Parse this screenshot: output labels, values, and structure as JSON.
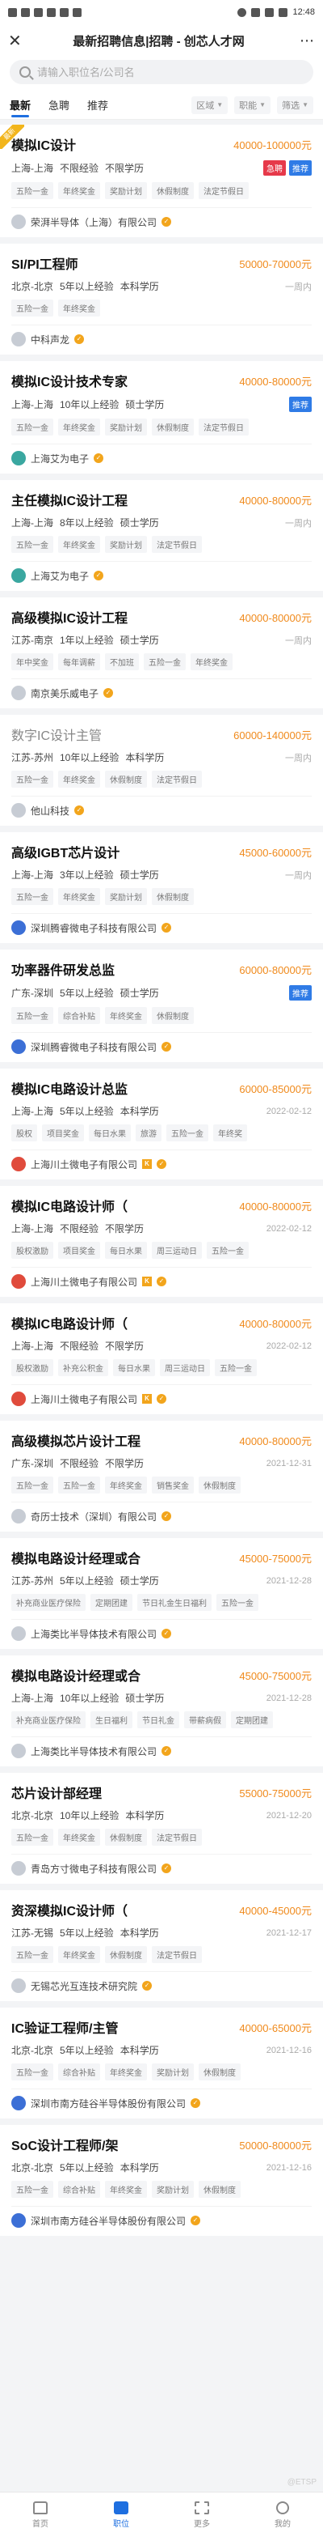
{
  "status_bar": {
    "left_icons": [
      "app-icon",
      "app-icon",
      "app-icon",
      "app-icon",
      "app-icon",
      "app-icon"
    ],
    "right": "12:48"
  },
  "header": {
    "title": "最新招聘信息|招聘 - 创芯人才网"
  },
  "search": {
    "placeholder": "请输入职位名/公司名"
  },
  "tabs": [
    {
      "label": "最新",
      "active": true
    },
    {
      "label": "急聘",
      "active": false
    },
    {
      "label": "推荐",
      "active": false
    }
  ],
  "filters": [
    {
      "label": "区域"
    },
    {
      "label": "职能"
    },
    {
      "label": "筛选"
    }
  ],
  "jobs": [
    {
      "title": "模拟IC设计",
      "salary": "40000-100000元",
      "reqs": [
        "上海-上海",
        "不限经验",
        "不限学历"
      ],
      "badges": [
        "急聘",
        "推荐"
      ],
      "tags": [
        "五险一金",
        "年终奖金",
        "奖励计划",
        "休假制度",
        "法定节假日"
      ],
      "company": "荣湃半导体（上海）有限公司",
      "ribbon": "最新"
    },
    {
      "title": "SI/PI工程师",
      "salary": "50000-70000元",
      "reqs": [
        "北京-北京",
        "5年以上经验",
        "本科学历"
      ],
      "date": "一周内",
      "tags": [
        "五险一金",
        "年终奖金"
      ],
      "company": "中科声龙"
    },
    {
      "title": "模拟IC设计技术专家",
      "salary": "40000-80000元",
      "reqs": [
        "上海-上海",
        "10年以上经验",
        "硕士学历"
      ],
      "badges": [
        "推荐"
      ],
      "tags": [
        "五险一金",
        "年终奖金",
        "奖励计划",
        "休假制度",
        "法定节假日"
      ],
      "company": "上海艾为电子"
    },
    {
      "title": "主任模拟IC设计工程",
      "salary": "40000-80000元",
      "reqs": [
        "上海-上海",
        "8年以上经验",
        "硕士学历"
      ],
      "date": "一周内",
      "tags": [
        "五险一金",
        "年终奖金",
        "奖励计划",
        "法定节假日"
      ],
      "company": "上海艾为电子"
    },
    {
      "title": "高级模拟IC设计工程",
      "salary": "40000-80000元",
      "reqs": [
        "江苏-南京",
        "1年以上经验",
        "硕士学历"
      ],
      "date": "一周内",
      "tags": [
        "年中奖金",
        "每年调薪",
        "不加班",
        "五险一金",
        "年终奖金"
      ],
      "company": "南京美乐威电子"
    },
    {
      "title": "数字IC设计主管",
      "salary": "60000-140000元",
      "reqs": [
        "江苏-苏州",
        "10年以上经验",
        "本科学历"
      ],
      "date": "一周内",
      "tags": [
        "五险一金",
        "年终奖金",
        "休假制度",
        "法定节假日"
      ],
      "company": "他山科技",
      "muted": true
    },
    {
      "title": "高级IGBT芯片设计",
      "salary": "45000-60000元",
      "reqs": [
        "上海-上海",
        "3年以上经验",
        "硕士学历"
      ],
      "date": "一周内",
      "tags": [
        "五险一金",
        "年终奖金",
        "奖励计划",
        "休假制度"
      ],
      "company": "深圳腾睿微电子科技有限公司"
    },
    {
      "title": "功率器件研发总监",
      "salary": "60000-80000元",
      "reqs": [
        "广东-深圳",
        "5年以上经验",
        "硕士学历"
      ],
      "badges": [
        "推荐"
      ],
      "tags": [
        "五险一金",
        "综合补贴",
        "年终奖金",
        "休假制度"
      ],
      "company": "深圳腾睿微电子科技有限公司"
    },
    {
      "title": "模拟IC电路设计总监",
      "salary": "60000-85000元",
      "reqs": [
        "上海-上海",
        "5年以上经验",
        "本科学历"
      ],
      "date": "2022-02-12",
      "tags": [
        "股权",
        "项目奖金",
        "每日水果",
        "旅游",
        "五险一金",
        "年终奖"
      ],
      "company": "上海川土微电子有限公司"
    },
    {
      "title": "模拟IC电路设计师（",
      "salary": "40000-80000元",
      "reqs": [
        "上海-上海",
        "不限经验",
        "不限学历"
      ],
      "date": "2022-02-12",
      "tags": [
        "股权激励",
        "项目奖金",
        "每日水果",
        "周三运动日",
        "五险一金"
      ],
      "company": "上海川土微电子有限公司"
    },
    {
      "title": "模拟IC电路设计师（",
      "salary": "40000-80000元",
      "reqs": [
        "上海-上海",
        "不限经验",
        "不限学历"
      ],
      "date": "2022-02-12",
      "tags": [
        "股权激励",
        "补充公积金",
        "每日水果",
        "周三运动日",
        "五险一金"
      ],
      "company": "上海川土微电子有限公司"
    },
    {
      "title": "高级模拟芯片设计工程",
      "salary": "40000-80000元",
      "reqs": [
        "广东-深圳",
        "不限经验",
        "不限学历"
      ],
      "date": "2021-12-31",
      "tags": [
        "五险一金",
        "五险一金",
        "年终奖金",
        "销售奖金",
        "休假制度"
      ],
      "company": "奇历士技术（深圳）有限公司"
    },
    {
      "title": "模拟电路设计经理或合",
      "salary": "45000-75000元",
      "reqs": [
        "江苏-苏州",
        "5年以上经验",
        "硕士学历"
      ],
      "date": "2021-12-28",
      "tags": [
        "补充商业医疗保险",
        "定期团建",
        "节日礼金生日福利",
        "五险一金"
      ],
      "company": "上海类比半导体技术有限公司"
    },
    {
      "title": "模拟电路设计经理或合",
      "salary": "45000-75000元",
      "reqs": [
        "上海-上海",
        "10年以上经验",
        "硕士学历"
      ],
      "date": "2021-12-28",
      "tags": [
        "补充商业医疗保险",
        "生日福利",
        "节日礼金",
        "带薪病假",
        "定期团建"
      ],
      "company": "上海类比半导体技术有限公司"
    },
    {
      "title": "芯片设计部经理",
      "salary": "55000-75000元",
      "reqs": [
        "北京-北京",
        "10年以上经验",
        "本科学历"
      ],
      "date": "2021-12-20",
      "tags": [
        "五险一金",
        "年终奖金",
        "休假制度",
        "法定节假日"
      ],
      "company": "青岛方寸微电子科技有限公司"
    },
    {
      "title": "资深模拟IC设计师（",
      "salary": "40000-45000元",
      "reqs": [
        "江苏-无锡",
        "5年以上经验",
        "本科学历"
      ],
      "date": "2021-12-17",
      "tags": [
        "五险一金",
        "年终奖金",
        "休假制度",
        "法定节假日"
      ],
      "company": "无锡芯光互连技术研究院"
    },
    {
      "title": "IC验证工程师/主管",
      "salary": "40000-65000元",
      "reqs": [
        "北京-北京",
        "5年以上经验",
        "本科学历"
      ],
      "date": "2021-12-16",
      "tags": [
        "五险一金",
        "综合补贴",
        "年终奖金",
        "奖励计划",
        "休假制度"
      ],
      "company": "深圳市南方硅谷半导体股份有限公司"
    },
    {
      "title": "SoC设计工程师/架",
      "salary": "50000-80000元",
      "reqs": [
        "北京-北京",
        "5年以上经验",
        "本科学历"
      ],
      "date": "2021-12-16",
      "tags": [
        "五险一金",
        "综合补贴",
        "年终奖金",
        "奖励计划",
        "休假制度"
      ],
      "company": "深圳市南方硅谷半导体股份有限公司"
    }
  ],
  "bottom_nav": [
    {
      "label": "首页",
      "icon": "home-icon",
      "active": false
    },
    {
      "label": "职位",
      "icon": "briefcase-icon",
      "active": true
    },
    {
      "label": "更多",
      "icon": "grid-icon",
      "active": false
    },
    {
      "label": "我的",
      "icon": "user-icon",
      "active": false
    }
  ],
  "watermark": "@ETSP"
}
